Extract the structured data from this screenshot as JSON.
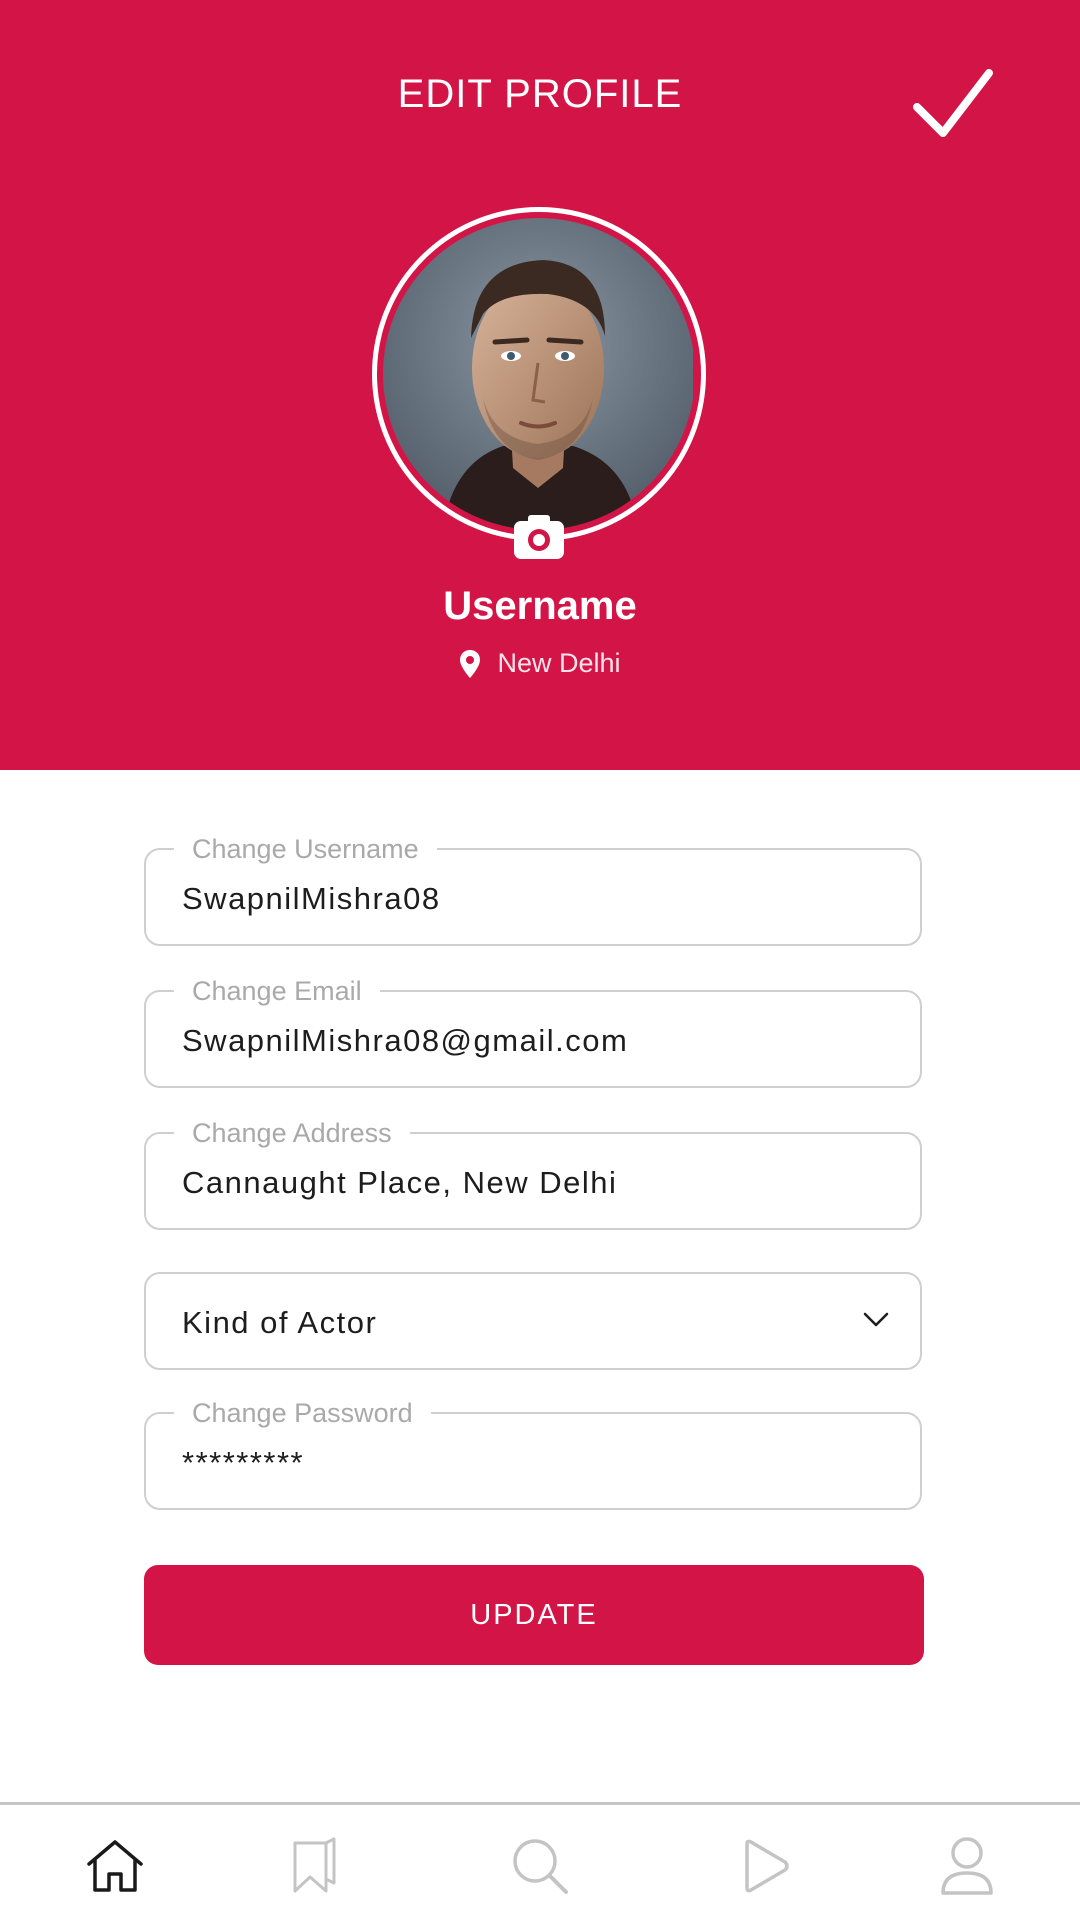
{
  "header": {
    "title": "EDIT PROFILE",
    "check_icon": "checkmark-icon",
    "camera_icon": "camera-icon",
    "username": "Username",
    "location_icon": "location-pin-icon",
    "location": "New Delhi",
    "background_color": "#d31447"
  },
  "form": {
    "username": {
      "label": "Change Username",
      "value": "SwapnilMishra08"
    },
    "email": {
      "label": "Change Email",
      "value": "SwapnilMishra08@gmail.com"
    },
    "address": {
      "label": "Change Address",
      "value": "Cannaught Place, New Delhi"
    },
    "actor_kind": {
      "value": "Kind of Actor",
      "icon": "chevron-down-icon"
    },
    "password": {
      "label": "Change Password",
      "value": "*********"
    },
    "update_label": "UPDATE"
  },
  "bottom_nav": [
    {
      "icon": "home-icon",
      "active": true
    },
    {
      "icon": "bookmark-icon",
      "active": false
    },
    {
      "icon": "search-icon",
      "active": false
    },
    {
      "icon": "play-icon",
      "active": false
    },
    {
      "icon": "profile-icon",
      "active": false
    }
  ],
  "colors": {
    "accent": "#d31447",
    "field_border": "#cfcfcf",
    "label": "#a9a9a9"
  }
}
